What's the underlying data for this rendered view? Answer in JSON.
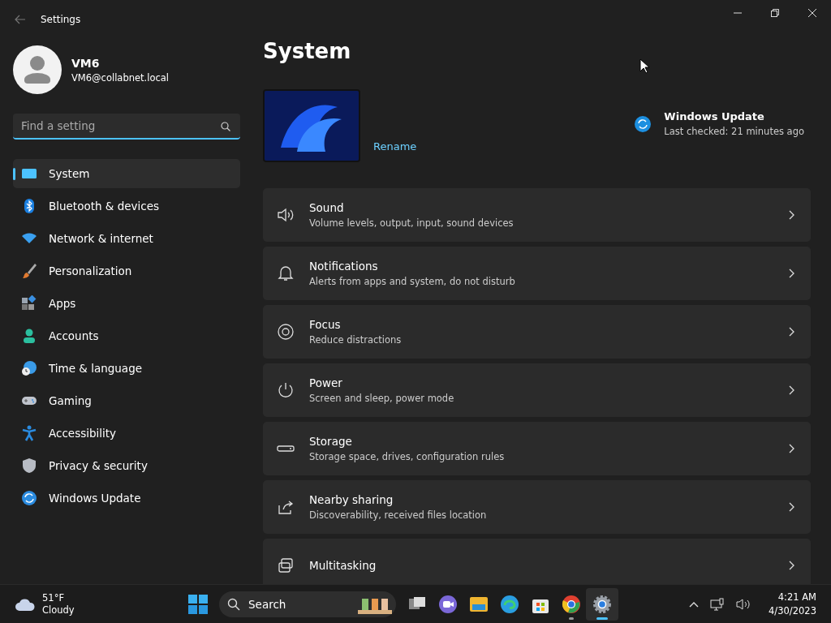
{
  "window": {
    "title": "Settings"
  },
  "user": {
    "name": "VM6",
    "email": "VM6@collabnet.local"
  },
  "search": {
    "placeholder": "Find a setting"
  },
  "nav": [
    {
      "label": "System",
      "selected": true
    },
    {
      "label": "Bluetooth & devices",
      "selected": false
    },
    {
      "label": "Network & internet",
      "selected": false
    },
    {
      "label": "Personalization",
      "selected": false
    },
    {
      "label": "Apps",
      "selected": false
    },
    {
      "label": "Accounts",
      "selected": false
    },
    {
      "label": "Time & language",
      "selected": false
    },
    {
      "label": "Gaming",
      "selected": false
    },
    {
      "label": "Accessibility",
      "selected": false
    },
    {
      "label": "Privacy & security",
      "selected": false
    },
    {
      "label": "Windows Update",
      "selected": false
    }
  ],
  "page": {
    "title": "System",
    "rename": "Rename",
    "update": {
      "title": "Windows Update",
      "status": "Last checked: 21 minutes ago"
    }
  },
  "settings": [
    {
      "title": "Sound",
      "subtitle": "Volume levels, output, input, sound devices"
    },
    {
      "title": "Notifications",
      "subtitle": "Alerts from apps and system, do not disturb"
    },
    {
      "title": "Focus",
      "subtitle": "Reduce distractions"
    },
    {
      "title": "Power",
      "subtitle": "Screen and sleep, power mode"
    },
    {
      "title": "Storage",
      "subtitle": "Storage space, drives, configuration rules"
    },
    {
      "title": "Nearby sharing",
      "subtitle": "Discoverability, received files location"
    },
    {
      "title": "Multitasking"
    }
  ],
  "taskbar": {
    "weather": {
      "temp": "51°F",
      "condition": "Cloudy"
    },
    "search": "Search",
    "apps": [
      {
        "open": false,
        "active": false
      },
      {
        "open": false,
        "active": false
      },
      {
        "open": false,
        "active": false
      },
      {
        "open": false,
        "active": false
      },
      {
        "open": false,
        "active": false
      },
      {
        "open": true,
        "active": false
      },
      {
        "open": true,
        "active": true
      }
    ],
    "time": "4:21 AM",
    "date": "4/30/2023"
  }
}
